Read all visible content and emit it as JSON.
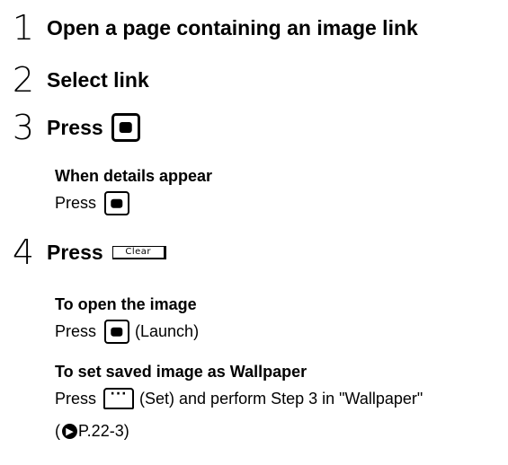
{
  "steps": [
    {
      "num": "1",
      "title": "Open a page containing an image link"
    },
    {
      "num": "2",
      "title": "Select link"
    },
    {
      "num": "3",
      "title": "Press"
    },
    {
      "num": "4",
      "title": "Press"
    }
  ],
  "step3_sub": {
    "heading": "When details appear",
    "text": "Press"
  },
  "step4_sub": {
    "open_heading": "To open the image",
    "open_text": "Press",
    "open_suffix": "(Launch)",
    "wallpaper_heading": "To set saved image as Wallpaper",
    "wallpaper_text": "Press",
    "wallpaper_suffix": "(Set) and perform Step 3 in \"Wallpaper\"",
    "ref_open": "(",
    "ref_text": "P.22-3)"
  },
  "keys": {
    "clear_label": "Clear",
    "soft_label": "···"
  },
  "icons": {
    "center_key": "center-key-icon",
    "clear_key": "clear-key-icon",
    "soft_key": "softkey-icon",
    "reference": "reference-arrow-icon"
  }
}
